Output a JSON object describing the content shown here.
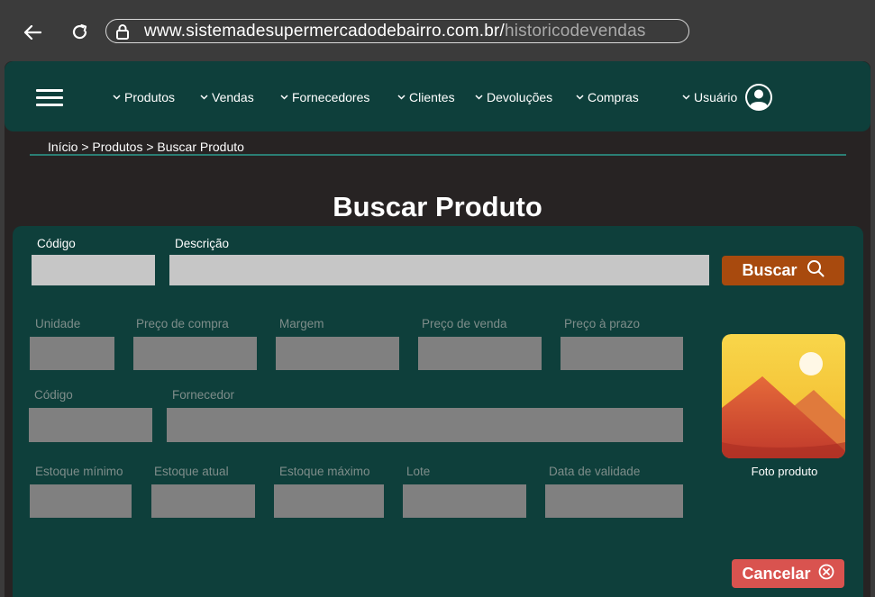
{
  "browser": {
    "url_domain": "www.sistemadesupermercadodebairro.com.br/",
    "url_path": "historicodevendas"
  },
  "nav": {
    "items": [
      {
        "label": "Produtos"
      },
      {
        "label": "Vendas"
      },
      {
        "label": "Fornecedores"
      },
      {
        "label": "Clientes"
      },
      {
        "label": "Devoluções"
      },
      {
        "label": "Compras"
      },
      {
        "label": "Usuário"
      }
    ]
  },
  "breadcrumb": "Início > Produtos > Buscar Produto",
  "page_title": "Buscar Produto",
  "search": {
    "codigo_label": "Código",
    "codigo_value": "",
    "descricao_label": "Descrição",
    "descricao_value": "",
    "button_label": "Buscar"
  },
  "details": {
    "unidade": "Unidade",
    "preco_compra": "Preço de compra",
    "margem": "Margem",
    "preco_venda": "Preço de venda",
    "preco_prazo": "Preço à prazo",
    "codigo": "Código",
    "fornecedor": "Fornecedor",
    "estoque_minimo": "Estoque mínimo",
    "estoque_atual": "Estoque atual",
    "estoque_maximo": "Estoque máximo",
    "lote": "Lote",
    "data_validade": "Data de validade"
  },
  "photo_caption": "Foto produto",
  "cancel_label": "Cancelar",
  "colors": {
    "nav_bg": "#0e3f3b",
    "page_bg": "#272323",
    "primary_button": "#a84a0e",
    "cancel_button": "#d9534f",
    "accent_line": "#2b7e74"
  },
  "icons": {
    "back": "arrow-left-icon",
    "reload": "reload-icon",
    "lock": "lock-icon",
    "menu": "hamburger-menu-icon",
    "chevron": "chevron-down-icon",
    "user": "user-avatar-icon",
    "search": "search-icon",
    "image": "image-placeholder-icon",
    "cancel": "close-circle-icon"
  }
}
